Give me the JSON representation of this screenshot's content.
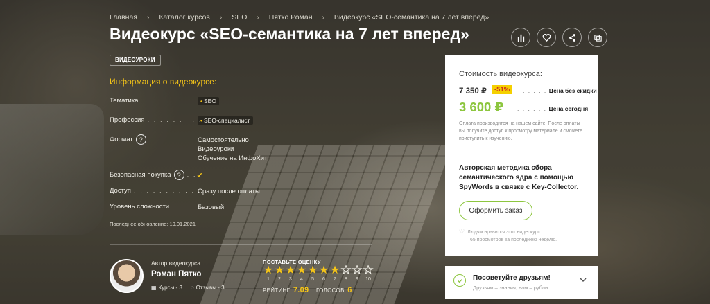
{
  "breadcrumb": [
    "Главная",
    "Каталог курсов",
    "SEO",
    "Пятко Роман",
    "Видеокурс «SEO-семантика на 7 лет вперед»"
  ],
  "page_title": "Видеокурс «SEO-семантика на 7 лет вперед»",
  "actions": [
    {
      "name": "stats-icon"
    },
    {
      "name": "heart-icon"
    },
    {
      "name": "share-icon"
    },
    {
      "name": "compare-icon"
    }
  ],
  "tag": "ВИДЕОУРОКИ",
  "info": {
    "heading": "Информация о видеокурсе:",
    "rows": [
      {
        "label": "Тематика",
        "dots": ". . . . . . . . . . . .",
        "values": [
          "SEO"
        ],
        "type": "pill"
      },
      {
        "label": "Профессия",
        "dots": ". . . . . . . . . . .",
        "values": [
          "SEO-специалист"
        ],
        "type": "pill"
      },
      {
        "label": "Формат",
        "dots": ". . . . . . . . . .",
        "values": [
          "Самостоятельно",
          "Видеоуроки",
          "Обучение на ИнфоХит"
        ],
        "type": "text",
        "help": "?"
      },
      {
        "label": "Безопасная покупка",
        "dots": ". .",
        "values": [
          "✔"
        ],
        "type": "check",
        "help": "?"
      },
      {
        "label": "Доступ",
        "dots": ". . . . . . . . . . . . . .",
        "values": [
          "Сразу после оплаты"
        ],
        "type": "text"
      },
      {
        "label": "Уровень сложности",
        "dots": ". . . . . .",
        "values": [
          "Базовый"
        ],
        "type": "text"
      }
    ],
    "updated": "Последнее обновление: 19.01.2021"
  },
  "author": {
    "caption": "Автор видеокурса",
    "name": "Роман Пятко",
    "courses": "Курсы - 3",
    "reviews": "Отзывы - 3"
  },
  "rating": {
    "caption": "ПОСТАВЬТЕ ОЦЕНКУ",
    "filled": 7,
    "max": 10,
    "numbers": [
      "1",
      "2",
      "3",
      "4",
      "5",
      "6",
      "7",
      "8",
      "9",
      "10"
    ],
    "rating_label": "РЕЙТИНГ",
    "rating_value": "7.09",
    "votes_label": "ГОЛОСОВ",
    "votes_value": "6"
  },
  "price_card": {
    "cost_label": "Стоимость видеокурса:",
    "old_price": "7 350 ₽",
    "discount": "-51%",
    "old_dots": ". . . . .",
    "old_label": "Цена без скидки",
    "new_price": "3 600 ₽",
    "new_dots": ". . . . . .",
    "new_label": "Цена сегодня",
    "pay_note": "Оплата производится на нашем сайте. После оплаты вы получите доступ к просмотру материале и сможете приступить к изучению.",
    "method": "Авторская методика сбора семантического ядра с помощью SpyWords в связке с Key-Collector.",
    "order_button": "Оформить заказ",
    "likes_line1": "Людям нравится этот видеокурс.",
    "likes_line2": "65 просмотров за последнюю неделю."
  },
  "friends": {
    "title": "Посоветуйте друзьям!",
    "subtitle": "Друзьям – знания, вам – рубли"
  },
  "colors": {
    "accent_yellow": "#f5c518",
    "accent_green": "#8dc63f",
    "discount_bg": "#f5d000",
    "discount_text": "#d0341d"
  }
}
